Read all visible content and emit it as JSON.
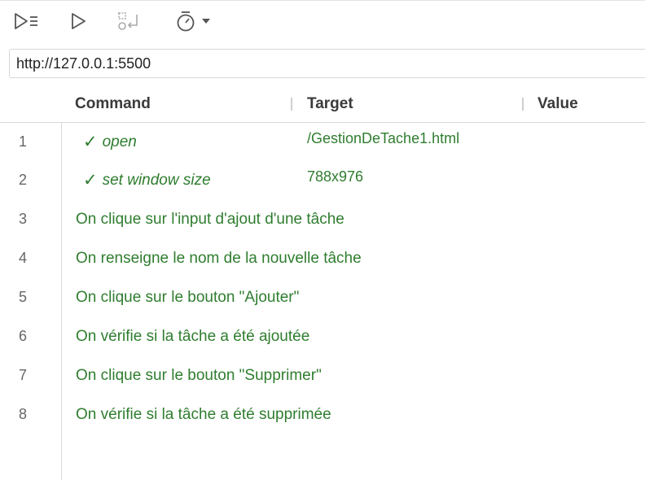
{
  "toolbar": {
    "buttons": [
      {
        "icon": "run-all-icon"
      },
      {
        "icon": "run-current-icon"
      },
      {
        "icon": "step-over-icon"
      },
      {
        "icon": "speed-timer-icon"
      }
    ]
  },
  "url": {
    "value": "http://127.0.0.1:5500"
  },
  "table": {
    "headers": {
      "command": "Command",
      "target": "Target",
      "value": "Value"
    },
    "rows": [
      {
        "num": "1",
        "command": "open",
        "target": "/GestionDeTache1.html",
        "value": ""
      },
      {
        "num": "2",
        "command": "set window size",
        "target": "788x976",
        "value": ""
      },
      {
        "num": "3",
        "comment": "On clique sur l'input d'ajout d'une tâche"
      },
      {
        "num": "4",
        "comment": "On renseigne le nom de la nouvelle tâche"
      },
      {
        "num": "5",
        "comment": "On clique sur le bouton \"Ajouter\""
      },
      {
        "num": "6",
        "comment": "On vérifie si la tâche a été ajoutée"
      },
      {
        "num": "7",
        "comment": "On clique sur le bouton \"Supprimer\""
      },
      {
        "num": "8",
        "comment": "On vérifie si la tâche a été supprimée"
      }
    ]
  },
  "colors": {
    "success": "#2f7d2f",
    "text": "#3a3a3a",
    "border": "#d8d8d8"
  }
}
